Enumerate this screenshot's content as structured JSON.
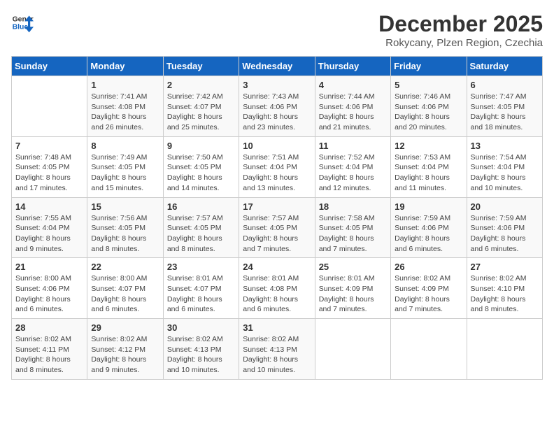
{
  "header": {
    "logo_line1": "General",
    "logo_line2": "Blue",
    "month": "December 2025",
    "location": "Rokycany, Plzen Region, Czechia"
  },
  "weekdays": [
    "Sunday",
    "Monday",
    "Tuesday",
    "Wednesday",
    "Thursday",
    "Friday",
    "Saturday"
  ],
  "weeks": [
    [
      {
        "day": "",
        "sunrise": "",
        "sunset": "",
        "daylight": ""
      },
      {
        "day": "1",
        "sunrise": "Sunrise: 7:41 AM",
        "sunset": "Sunset: 4:08 PM",
        "daylight": "Daylight: 8 hours and 26 minutes."
      },
      {
        "day": "2",
        "sunrise": "Sunrise: 7:42 AM",
        "sunset": "Sunset: 4:07 PM",
        "daylight": "Daylight: 8 hours and 25 minutes."
      },
      {
        "day": "3",
        "sunrise": "Sunrise: 7:43 AM",
        "sunset": "Sunset: 4:06 PM",
        "daylight": "Daylight: 8 hours and 23 minutes."
      },
      {
        "day": "4",
        "sunrise": "Sunrise: 7:44 AM",
        "sunset": "Sunset: 4:06 PM",
        "daylight": "Daylight: 8 hours and 21 minutes."
      },
      {
        "day": "5",
        "sunrise": "Sunrise: 7:46 AM",
        "sunset": "Sunset: 4:06 PM",
        "daylight": "Daylight: 8 hours and 20 minutes."
      },
      {
        "day": "6",
        "sunrise": "Sunrise: 7:47 AM",
        "sunset": "Sunset: 4:05 PM",
        "daylight": "Daylight: 8 hours and 18 minutes."
      }
    ],
    [
      {
        "day": "7",
        "sunrise": "Sunrise: 7:48 AM",
        "sunset": "Sunset: 4:05 PM",
        "daylight": "Daylight: 8 hours and 17 minutes."
      },
      {
        "day": "8",
        "sunrise": "Sunrise: 7:49 AM",
        "sunset": "Sunset: 4:05 PM",
        "daylight": "Daylight: 8 hours and 15 minutes."
      },
      {
        "day": "9",
        "sunrise": "Sunrise: 7:50 AM",
        "sunset": "Sunset: 4:05 PM",
        "daylight": "Daylight: 8 hours and 14 minutes."
      },
      {
        "day": "10",
        "sunrise": "Sunrise: 7:51 AM",
        "sunset": "Sunset: 4:04 PM",
        "daylight": "Daylight: 8 hours and 13 minutes."
      },
      {
        "day": "11",
        "sunrise": "Sunrise: 7:52 AM",
        "sunset": "Sunset: 4:04 PM",
        "daylight": "Daylight: 8 hours and 12 minutes."
      },
      {
        "day": "12",
        "sunrise": "Sunrise: 7:53 AM",
        "sunset": "Sunset: 4:04 PM",
        "daylight": "Daylight: 8 hours and 11 minutes."
      },
      {
        "day": "13",
        "sunrise": "Sunrise: 7:54 AM",
        "sunset": "Sunset: 4:04 PM",
        "daylight": "Daylight: 8 hours and 10 minutes."
      }
    ],
    [
      {
        "day": "14",
        "sunrise": "Sunrise: 7:55 AM",
        "sunset": "Sunset: 4:04 PM",
        "daylight": "Daylight: 8 hours and 9 minutes."
      },
      {
        "day": "15",
        "sunrise": "Sunrise: 7:56 AM",
        "sunset": "Sunset: 4:05 PM",
        "daylight": "Daylight: 8 hours and 8 minutes."
      },
      {
        "day": "16",
        "sunrise": "Sunrise: 7:57 AM",
        "sunset": "Sunset: 4:05 PM",
        "daylight": "Daylight: 8 hours and 8 minutes."
      },
      {
        "day": "17",
        "sunrise": "Sunrise: 7:57 AM",
        "sunset": "Sunset: 4:05 PM",
        "daylight": "Daylight: 8 hours and 7 minutes."
      },
      {
        "day": "18",
        "sunrise": "Sunrise: 7:58 AM",
        "sunset": "Sunset: 4:05 PM",
        "daylight": "Daylight: 8 hours and 7 minutes."
      },
      {
        "day": "19",
        "sunrise": "Sunrise: 7:59 AM",
        "sunset": "Sunset: 4:06 PM",
        "daylight": "Daylight: 8 hours and 6 minutes."
      },
      {
        "day": "20",
        "sunrise": "Sunrise: 7:59 AM",
        "sunset": "Sunset: 4:06 PM",
        "daylight": "Daylight: 8 hours and 6 minutes."
      }
    ],
    [
      {
        "day": "21",
        "sunrise": "Sunrise: 8:00 AM",
        "sunset": "Sunset: 4:06 PM",
        "daylight": "Daylight: 8 hours and 6 minutes."
      },
      {
        "day": "22",
        "sunrise": "Sunrise: 8:00 AM",
        "sunset": "Sunset: 4:07 PM",
        "daylight": "Daylight: 8 hours and 6 minutes."
      },
      {
        "day": "23",
        "sunrise": "Sunrise: 8:01 AM",
        "sunset": "Sunset: 4:07 PM",
        "daylight": "Daylight: 8 hours and 6 minutes."
      },
      {
        "day": "24",
        "sunrise": "Sunrise: 8:01 AM",
        "sunset": "Sunset: 4:08 PM",
        "daylight": "Daylight: 8 hours and 6 minutes."
      },
      {
        "day": "25",
        "sunrise": "Sunrise: 8:01 AM",
        "sunset": "Sunset: 4:09 PM",
        "daylight": "Daylight: 8 hours and 7 minutes."
      },
      {
        "day": "26",
        "sunrise": "Sunrise: 8:02 AM",
        "sunset": "Sunset: 4:09 PM",
        "daylight": "Daylight: 8 hours and 7 minutes."
      },
      {
        "day": "27",
        "sunrise": "Sunrise: 8:02 AM",
        "sunset": "Sunset: 4:10 PM",
        "daylight": "Daylight: 8 hours and 8 minutes."
      }
    ],
    [
      {
        "day": "28",
        "sunrise": "Sunrise: 8:02 AM",
        "sunset": "Sunset: 4:11 PM",
        "daylight": "Daylight: 8 hours and 8 minutes."
      },
      {
        "day": "29",
        "sunrise": "Sunrise: 8:02 AM",
        "sunset": "Sunset: 4:12 PM",
        "daylight": "Daylight: 8 hours and 9 minutes."
      },
      {
        "day": "30",
        "sunrise": "Sunrise: 8:02 AM",
        "sunset": "Sunset: 4:13 PM",
        "daylight": "Daylight: 8 hours and 10 minutes."
      },
      {
        "day": "31",
        "sunrise": "Sunrise: 8:02 AM",
        "sunset": "Sunset: 4:13 PM",
        "daylight": "Daylight: 8 hours and 10 minutes."
      },
      {
        "day": "",
        "sunrise": "",
        "sunset": "",
        "daylight": ""
      },
      {
        "day": "",
        "sunrise": "",
        "sunset": "",
        "daylight": ""
      },
      {
        "day": "",
        "sunrise": "",
        "sunset": "",
        "daylight": ""
      }
    ]
  ]
}
